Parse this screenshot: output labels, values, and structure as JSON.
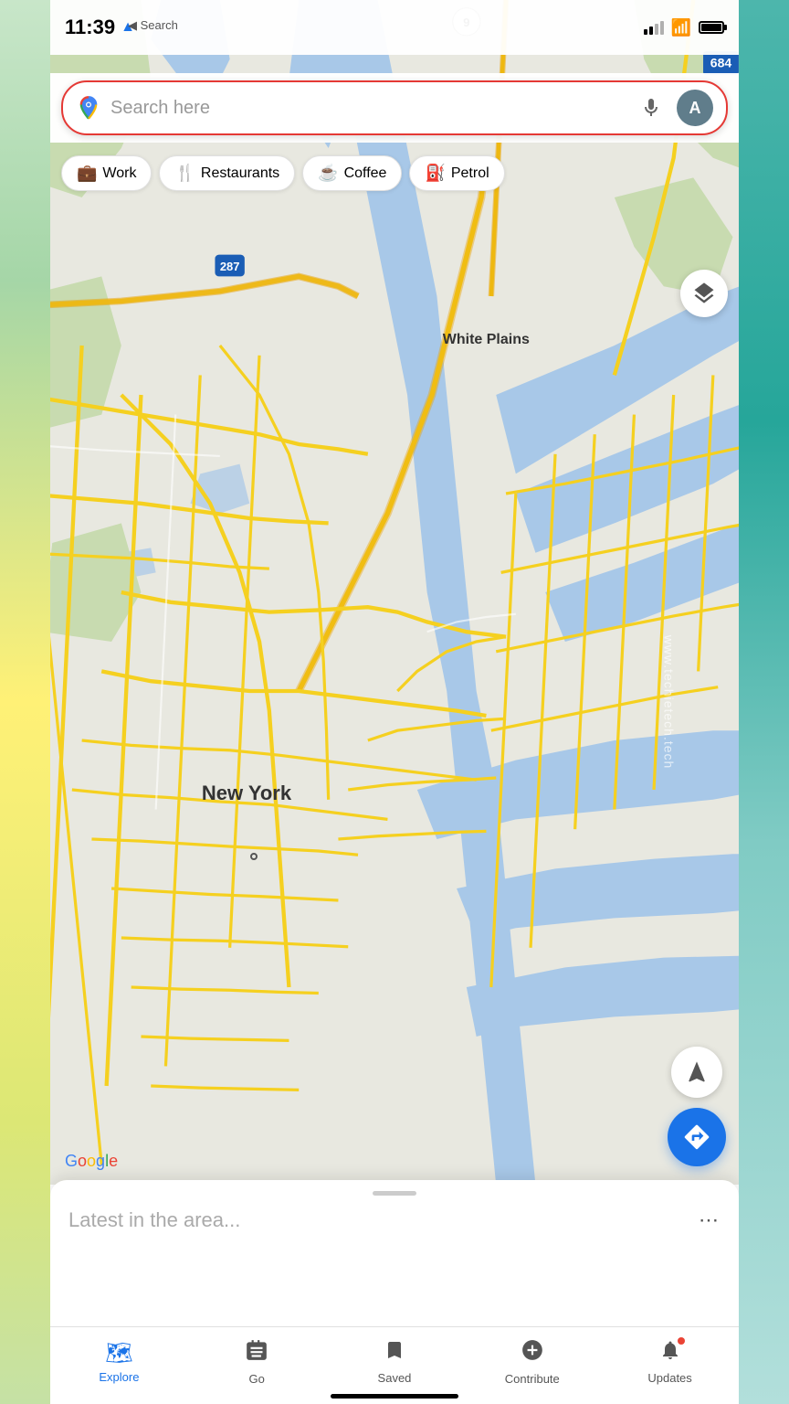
{
  "statusBar": {
    "time": "11:39",
    "backLabel": "◀ Search"
  },
  "searchBar": {
    "placeholder": "Search here",
    "avatarInitial": "A"
  },
  "categories": [
    {
      "id": "work",
      "icon": "💼",
      "label": "Work"
    },
    {
      "id": "restaurants",
      "icon": "🍴",
      "label": "Restaurants"
    },
    {
      "id": "coffee",
      "icon": "☕",
      "label": "Coffee"
    },
    {
      "id": "petrol",
      "icon": "⛽",
      "label": "Petrol"
    }
  ],
  "mapLabels": [
    {
      "text": "White Plains",
      "x": "62%",
      "y": "28%"
    },
    {
      "text": "New York",
      "x": "32%",
      "y": "68%"
    }
  ],
  "map": {
    "highway287": "287",
    "highway9": "9",
    "highway684": "684"
  },
  "googleWatermark": {
    "g": "G",
    "o1": "o",
    "o2": "o",
    "g2": "g",
    "l": "l",
    "e": "e"
  },
  "bottomSheet": {
    "title": "Latest in the area...",
    "moreIcon": "⋯"
  },
  "bottomNav": [
    {
      "id": "explore",
      "icon": "🗺",
      "label": "Explore",
      "active": true
    },
    {
      "id": "go",
      "icon": "🚌",
      "label": "Go",
      "active": false
    },
    {
      "id": "saved",
      "icon": "🔖",
      "label": "Saved",
      "active": false
    },
    {
      "id": "contribute",
      "icon": "⊕",
      "label": "Contribute",
      "active": false
    },
    {
      "id": "updates",
      "icon": "🔔",
      "label": "Updates",
      "active": false,
      "badge": true
    }
  ],
  "buttons": {
    "layerLabel": "⬡",
    "locationLabel": "➤",
    "navigateLabel": "➤"
  },
  "watermark": "www.techietech.tech"
}
